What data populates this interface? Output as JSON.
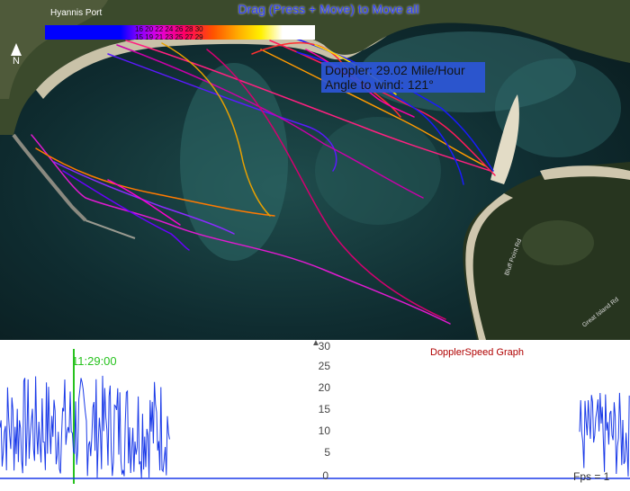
{
  "map": {
    "title": "Drag (Press + Move) to Move all",
    "place_label": "Hyannis Port",
    "north_label": "N",
    "road_labels": [
      "Bluff Point Rd",
      "Great Island Rd"
    ],
    "legend": {
      "row1": "16 20 22 24 26 28 30",
      "row2": "15 19 21 23 25 27 29"
    },
    "info": {
      "doppler": "Doppler: 29.02 Mile/Hour",
      "angle": "Angle to wind: 121°"
    }
  },
  "graph": {
    "title": "DopplerSpeed Graph",
    "time_label": "11:29:00",
    "bottom_label": "0",
    "fps_label": "Fps = 1",
    "y_ticks": [
      "30",
      "25",
      "20",
      "15",
      "10",
      "5"
    ],
    "colors": {
      "line": "#1a3ae8",
      "cursor": "#27c21e",
      "title": "#b00000"
    }
  },
  "chart_data": {
    "type": "line",
    "title": "DopplerSpeed Graph",
    "ylim": [
      0,
      30
    ],
    "y_ticks": [
      5,
      10,
      15,
      20,
      25,
      30
    ],
    "series": [
      {
        "segments": [
          {
            "x_frac": [
              0.0,
              0.27
            ],
            "range": [
              0,
              24
            ]
          },
          {
            "x_frac": [
              0.92,
              1.0
            ],
            "range": [
              0,
              20
            ]
          }
        ]
      }
    ]
  }
}
